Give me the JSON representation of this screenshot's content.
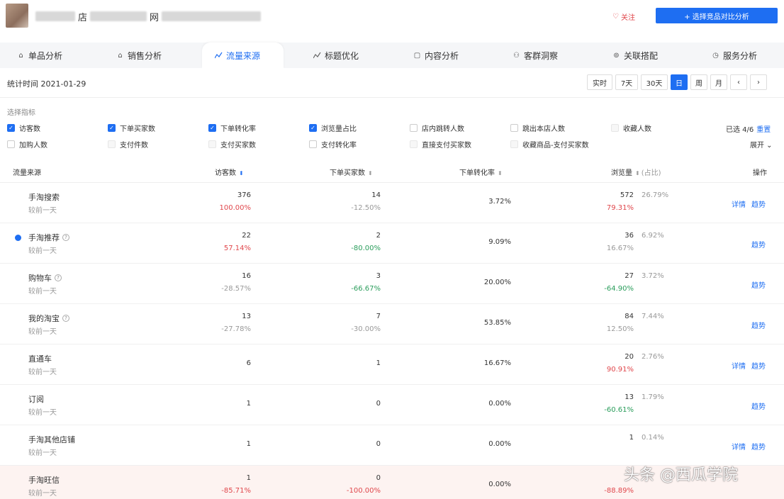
{
  "header": {
    "title_char_1": "店",
    "title_char_2": "网",
    "follow_label": "关注",
    "compare_button": "+ 选择竞品对比分析"
  },
  "tabs": [
    {
      "label": "单品分析",
      "icon": "home-icon"
    },
    {
      "label": "销售分析",
      "icon": "home-icon"
    },
    {
      "label": "流量来源",
      "icon": "line-chart-icon",
      "active": true
    },
    {
      "label": "标题优化",
      "icon": "line-chart-icon"
    },
    {
      "label": "内容分析",
      "icon": "doc-icon"
    },
    {
      "label": "客群洞察",
      "icon": "users-icon"
    },
    {
      "label": "关联搭配",
      "icon": "link-icon"
    },
    {
      "label": "服务分析",
      "icon": "clock-icon"
    }
  ],
  "toolbar": {
    "stat_date": "统计时间 2021-01-29",
    "ranges": [
      "实时",
      "7天",
      "30天",
      "日",
      "周",
      "月"
    ],
    "active_range": "日"
  },
  "metrics": {
    "label": "选择指标",
    "items": [
      {
        "label": "访客数",
        "state": "on"
      },
      {
        "label": "下单买家数",
        "state": "on"
      },
      {
        "label": "下单转化率",
        "state": "on"
      },
      {
        "label": "浏览量占比",
        "state": "on"
      },
      {
        "label": "店内跳转人数",
        "state": "off"
      },
      {
        "label": "跳出本店人数",
        "state": "off"
      },
      {
        "label": "收藏人数",
        "state": "dis"
      },
      {
        "label": "加购人数",
        "state": "off"
      },
      {
        "label": "支付件数",
        "state": "dis"
      },
      {
        "label": "支付买家数",
        "state": "dis"
      },
      {
        "label": "支付转化率",
        "state": "off"
      },
      {
        "label": "直接支付买家数",
        "state": "dis"
      },
      {
        "label": "收藏商品-支付买家数",
        "state": "dis"
      }
    ],
    "selected_info": "已选 4/6",
    "reset_label": "重置",
    "expand_label": "展开 ⌄"
  },
  "table": {
    "headers": {
      "source": "流量来源",
      "visitors": "访客数",
      "buyers": "下单买家数",
      "conversion": "下单转化率",
      "pv_share": "浏览量",
      "pv_share_sub": "(占比)",
      "ops": "操作"
    },
    "rows": [
      {
        "name": "手淘搜索",
        "sub": "较前一天",
        "help": false,
        "dot": false,
        "visitors": "376",
        "visitors_chg": "100.00%",
        "visitors_dir": "up",
        "buyers": "14",
        "buyers_chg": "-12.50%",
        "buyers_dir": "gray",
        "conversion": "3.72%",
        "pv": "572",
        "pv_share": "26.79%",
        "pv_chg": "79.31%",
        "pv_dir": "up",
        "ops": [
          "详情",
          "趋势"
        ]
      },
      {
        "name": "手淘推荐",
        "sub": "较前一天",
        "help": true,
        "dot": true,
        "visitors": "22",
        "visitors_chg": "57.14%",
        "visitors_dir": "up",
        "buyers": "2",
        "buyers_chg": "-80.00%",
        "buyers_dir": "down",
        "conversion": "9.09%",
        "pv": "36",
        "pv_share": "6.92%",
        "pv_chg": "16.67%",
        "pv_dir": "gray",
        "ops": [
          "趋势"
        ]
      },
      {
        "name": "购物车",
        "sub": "较前一天",
        "help": true,
        "dot": false,
        "visitors": "16",
        "visitors_chg": "-28.57%",
        "visitors_dir": "gray",
        "buyers": "3",
        "buyers_chg": "-66.67%",
        "buyers_dir": "down",
        "conversion": "20.00%",
        "pv": "27",
        "pv_share": "3.72%",
        "pv_chg": "-64.90%",
        "pv_dir": "down",
        "ops": [
          "趋势"
        ]
      },
      {
        "name": "我的淘宝",
        "sub": "较前一天",
        "help": true,
        "dot": false,
        "visitors": "13",
        "visitors_chg": "-27.78%",
        "visitors_dir": "gray",
        "buyers": "7",
        "buyers_chg": "-30.00%",
        "buyers_dir": "gray",
        "conversion": "53.85%",
        "pv": "84",
        "pv_share": "7.44%",
        "pv_chg": "12.50%",
        "pv_dir": "gray",
        "ops": [
          "趋势"
        ]
      },
      {
        "name": "直通车",
        "sub": "较前一天",
        "help": false,
        "dot": false,
        "visitors": "6",
        "visitors_chg": "",
        "visitors_dir": "gray",
        "buyers": "1",
        "buyers_chg": "",
        "buyers_dir": "gray",
        "conversion": "16.67%",
        "pv": "20",
        "pv_share": "2.76%",
        "pv_chg": "90.91%",
        "pv_dir": "up",
        "ops": [
          "详情",
          "趋势"
        ]
      },
      {
        "name": "订阅",
        "sub": "较前一天",
        "help": false,
        "dot": false,
        "visitors": "1",
        "visitors_chg": "",
        "visitors_dir": "gray",
        "buyers": "0",
        "buyers_chg": "",
        "buyers_dir": "gray",
        "conversion": "0.00%",
        "pv": "13",
        "pv_share": "1.79%",
        "pv_chg": "-60.61%",
        "pv_dir": "down",
        "ops": [
          "趋势"
        ]
      },
      {
        "name": "手淘其他店铺",
        "sub": "较前一天",
        "help": false,
        "dot": false,
        "visitors": "1",
        "visitors_chg": "",
        "visitors_dir": "gray",
        "buyers": "0",
        "buyers_chg": "",
        "buyers_dir": "gray",
        "conversion": "0.00%",
        "pv": "1",
        "pv_share": "0.14%",
        "pv_chg": "",
        "pv_dir": "gray",
        "ops": [
          "详情",
          "趋势"
        ]
      },
      {
        "name": "手淘旺信",
        "sub": "较前一天",
        "help": false,
        "dot": false,
        "highlight": true,
        "visitors": "1",
        "visitors_chg": "-85.71%",
        "visitors_dir": "up",
        "buyers": "0",
        "buyers_chg": "-100.00%",
        "buyers_dir": "up",
        "conversion": "0.00%",
        "pv": "",
        "pv_share": "",
        "pv_chg": "-88.89%",
        "pv_dir": "up",
        "ops": []
      }
    ]
  },
  "watermark": "头条 @西瓜学院",
  "colors": {
    "accent": "#1e6ef2",
    "up": "#e0474c",
    "down": "#2a9d5b"
  }
}
